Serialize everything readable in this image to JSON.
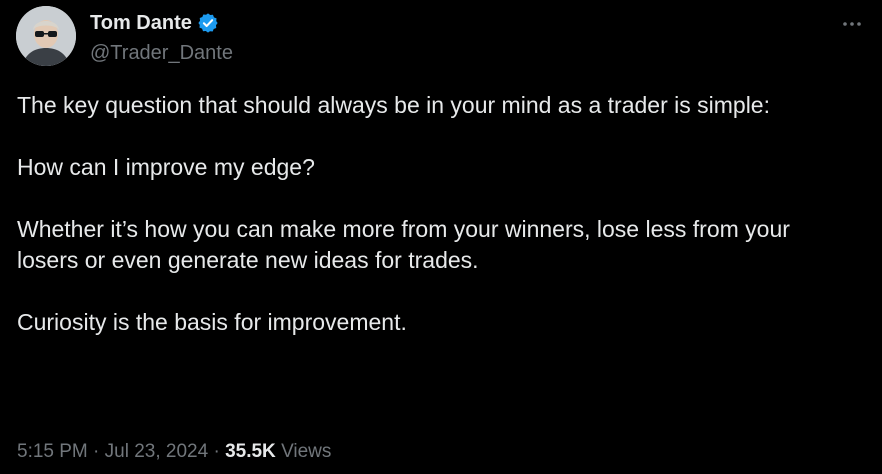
{
  "user": {
    "display_name": "Tom Dante",
    "handle": "@Trader_Dante",
    "verified_color": "#1d9bf0"
  },
  "tweet": {
    "paragraphs": [
      "The key question that should always be in your mind as a trader is simple:",
      "How can I improve my edge?",
      "Whether it’s how you can make more from your winners, lose less from your losers or even generate new ideas for trades.",
      "Curiosity is the basis for improvement."
    ]
  },
  "meta": {
    "time": "5:15 PM",
    "separator": "·",
    "date": "Jul 23, 2024",
    "views_count": "35.5K",
    "views_label": "Views"
  },
  "icons": {
    "verified": "verified-badge-icon",
    "more": "more-options-icon"
  }
}
